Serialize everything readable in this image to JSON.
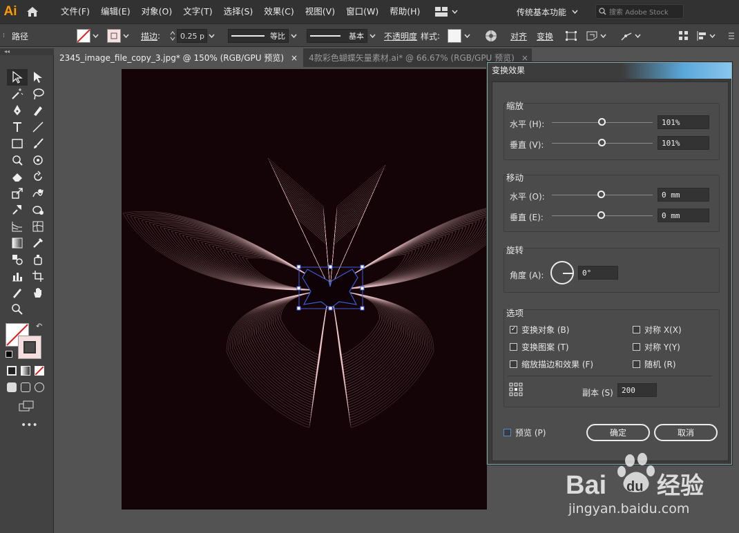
{
  "app": {
    "logo": "Ai"
  },
  "menu": [
    "文件(F)",
    "编辑(E)",
    "对象(O)",
    "文字(T)",
    "选择(S)",
    "效果(C)",
    "视图(V)",
    "窗口(W)",
    "帮助(H)"
  ],
  "workspace": "传统基本功能",
  "search_placeholder": "搜索 Adobe Stock",
  "control": {
    "path_label": "路径",
    "stroke_label": "描边",
    "stroke_value": "0.25 p",
    "profile_label": "等比",
    "brush_label": "基本",
    "opacity_label": "不透明度",
    "style_label": "样式",
    "align_label": "对齐",
    "transform_label": "变换"
  },
  "tabs": [
    {
      "label": "2345_image_file_copy_3.jpg* @ 150% (RGB/GPU 预览)",
      "close": "×"
    },
    {
      "label": "4款彩色蝴蝶矢量素材.ai* @ 66.67% (RGB/GPU 预览)",
      "close": "×"
    }
  ],
  "dialog": {
    "title": "变换效果",
    "scale": {
      "title": "缩放",
      "h_label": "水平 (H):",
      "h_value": "101%",
      "v_label": "垂直 (V):",
      "v_value": "101%"
    },
    "move": {
      "title": "移动",
      "h_label": "水平 (O):",
      "h_value": "0 mm",
      "v_label": "垂直 (E):",
      "v_value": "0 mm"
    },
    "rotate": {
      "title": "旋转",
      "angle_label": "角度 (A):",
      "angle_value": "0°"
    },
    "options": {
      "title": "选项",
      "transform_objects": {
        "label": "变换对象 (B)",
        "checked": true
      },
      "transform_patterns": {
        "label": "变换图案 (T)",
        "checked": false
      },
      "scale_strokes": {
        "label": "缩放描边和效果 (F)",
        "checked": false
      },
      "reflect_x": {
        "label": "对称 X(X)",
        "checked": false
      },
      "reflect_y": {
        "label": "对称 Y(Y)",
        "checked": false
      },
      "random": {
        "label": "随机 (R)",
        "checked": false
      },
      "copies_label": "副本 (S)",
      "copies_value": "200"
    },
    "preview": {
      "label": "预览 (P)",
      "checked": false
    },
    "ok": "确定",
    "cancel": "取消"
  },
  "watermark": {
    "brand": "Bai",
    "brand2": "du",
    "cn": "经验",
    "url": "jingyan.baidu.com"
  },
  "colors": {
    "artboard": "#150407",
    "butterfly": "#f3c9cc",
    "selection": "#3b5bd6",
    "logo": "#ff9a00"
  }
}
